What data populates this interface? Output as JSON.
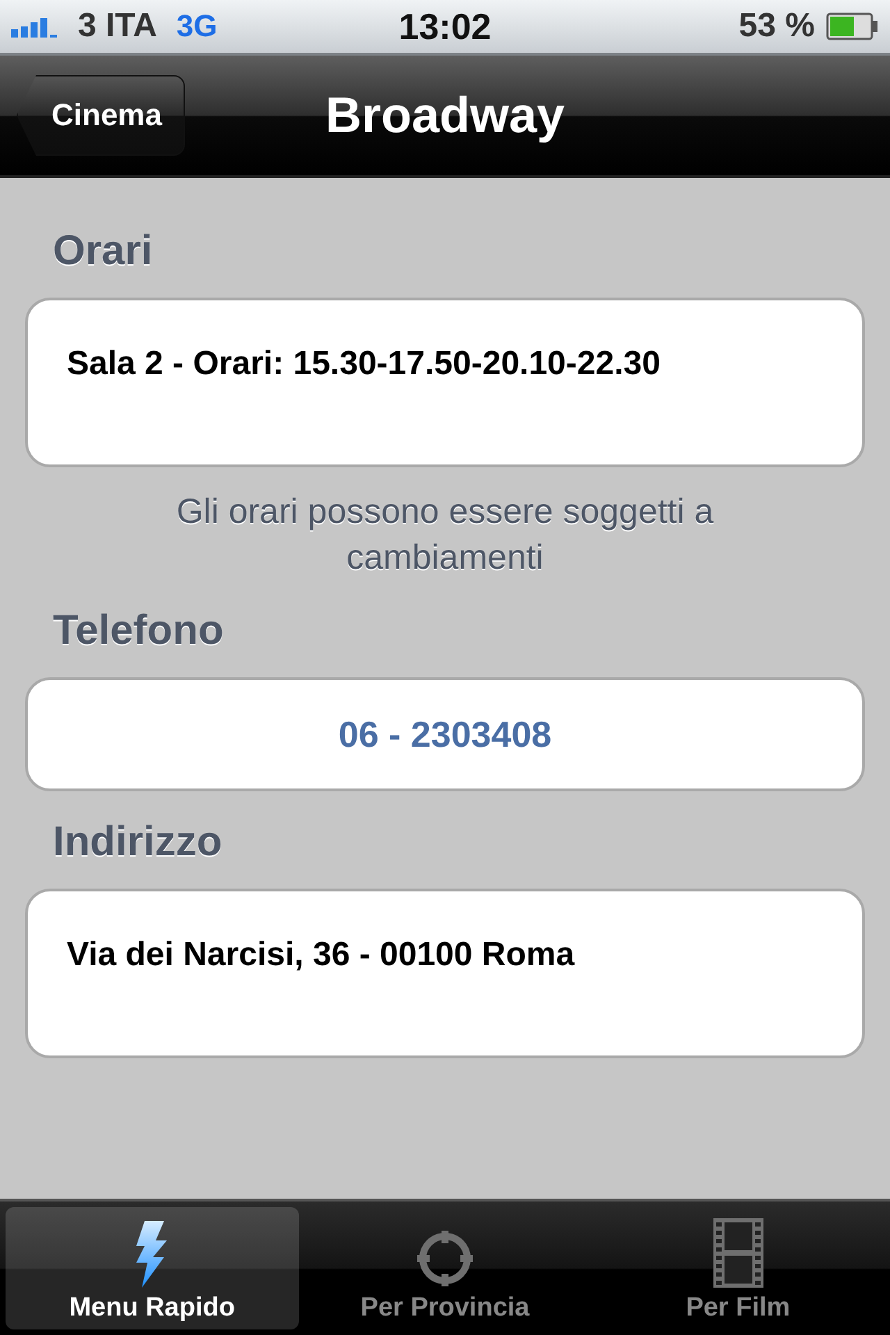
{
  "status_bar": {
    "carrier": "3 ITA",
    "network": "3G",
    "time": "13:02",
    "battery": "53 %"
  },
  "nav_bar": {
    "back": "Cinema",
    "title": "Broadway"
  },
  "sections": [
    {
      "header": "Orari",
      "kind": "text",
      "value": "Sala 2 - Orari: 15.30-17.50-20.10-22.30",
      "footer": "Gli orari possono essere soggetti a cambiamenti"
    },
    {
      "header": "Telefono",
      "kind": "link",
      "value": "06 - 2303408"
    },
    {
      "header": "Indirizzo",
      "kind": "text",
      "value": "Via dei Narcisi, 36 - 00100 Roma"
    }
  ],
  "tab_bar": [
    {
      "label": "Menu Rapido",
      "kind": "bolt",
      "selected": true
    },
    {
      "label": "Per Provincia",
      "kind": "target",
      "selected": false
    },
    {
      "label": "Per Film",
      "kind": "film",
      "selected": false
    }
  ]
}
